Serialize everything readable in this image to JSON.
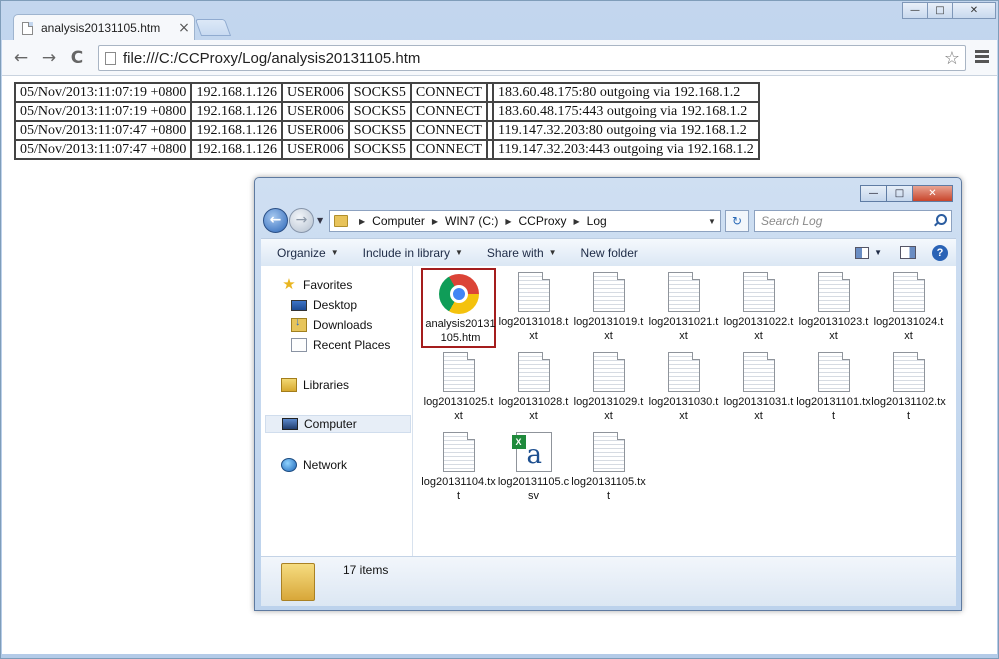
{
  "browser": {
    "tab_title": "analysis20131105.htm",
    "tab_close": "×",
    "url": "file:///C:/CCProxy/Log/analysis20131105.htm",
    "nav_back": "←",
    "nav_forward": "→",
    "nav_reload": "C",
    "star": "☆",
    "window_buttons": {
      "minimize": "—",
      "maximize": "□",
      "close": "✕"
    }
  },
  "log_rows": [
    [
      "05/Nov/2013:11:07:19 +0800",
      "192.168.1.126",
      "USER006",
      "SOCKS5",
      "CONNECT",
      "",
      "183.60.48.175:80 outgoing via 192.168.1.2"
    ],
    [
      "05/Nov/2013:11:07:19 +0800",
      "192.168.1.126",
      "USER006",
      "SOCKS5",
      "CONNECT",
      "",
      "183.60.48.175:443 outgoing via 192.168.1.2"
    ],
    [
      "05/Nov/2013:11:07:47 +0800",
      "192.168.1.126",
      "USER006",
      "SOCKS5",
      "CONNECT",
      "",
      "119.147.32.203:80 outgoing via 192.168.1.2"
    ],
    [
      "05/Nov/2013:11:07:47 +0800",
      "192.168.1.126",
      "USER006",
      "SOCKS5",
      "CONNECT",
      "",
      "119.147.32.203:443 outgoing via 192.168.1.2"
    ]
  ],
  "explorer": {
    "window_buttons": {
      "minimize": "—",
      "maximize": "□",
      "close": "✕"
    },
    "breadcrumb": [
      "Computer",
      "WIN7 (C:)",
      "CCProxy",
      "Log"
    ],
    "search_placeholder": "Search Log",
    "commands": {
      "organize": "Organize",
      "include_in_library": "Include in library",
      "share_with": "Share with",
      "new_folder": "New folder"
    },
    "nav": {
      "favorites": "Favorites",
      "desktop": "Desktop",
      "downloads": "Downloads",
      "recent_places": "Recent Places",
      "libraries": "Libraries",
      "computer": "Computer",
      "network": "Network"
    },
    "files": [
      {
        "name": "analysis20131105.htm",
        "label": "analysis20131105.htm",
        "type": "chrome"
      },
      {
        "name": "log20131018.txt",
        "label": "log20131018.txt",
        "type": "txt"
      },
      {
        "name": "log20131019.txt",
        "label": "log20131019.txt",
        "type": "txt"
      },
      {
        "name": "log20131021.txt",
        "label": "log20131021.txt",
        "type": "txt"
      },
      {
        "name": "log20131022.txt",
        "label": "log20131022.txt",
        "type": "txt"
      },
      {
        "name": "log20131023.txt",
        "label": "log20131023.txt",
        "type": "txt"
      },
      {
        "name": "log20131024.txt",
        "label": "log20131024.txt",
        "type": "txt"
      },
      {
        "name": "log20131025.txt",
        "label": "log20131025.txt",
        "type": "txt"
      },
      {
        "name": "log20131028.txt",
        "label": "log20131028.txt",
        "type": "txt"
      },
      {
        "name": "log20131029.txt",
        "label": "log20131029.txt",
        "type": "txt"
      },
      {
        "name": "log20131030.txt",
        "label": "log20131030.txt",
        "type": "txt"
      },
      {
        "name": "log20131031.txt",
        "label": "log20131031.txt",
        "type": "txt"
      },
      {
        "name": "log20131101.txt",
        "label": "log20131101.txt",
        "type": "txt"
      },
      {
        "name": "log20131102.txt",
        "label": "log20131102.txt",
        "type": "txt"
      },
      {
        "name": "log20131104.txt",
        "label": "log20131104.txt",
        "type": "txt"
      },
      {
        "name": "log20131105.csv",
        "label": "log20131105.csv",
        "type": "csv"
      },
      {
        "name": "log20131105.txt",
        "label": "log20131105.txt",
        "type": "txt"
      }
    ],
    "status_count": "17 items"
  }
}
